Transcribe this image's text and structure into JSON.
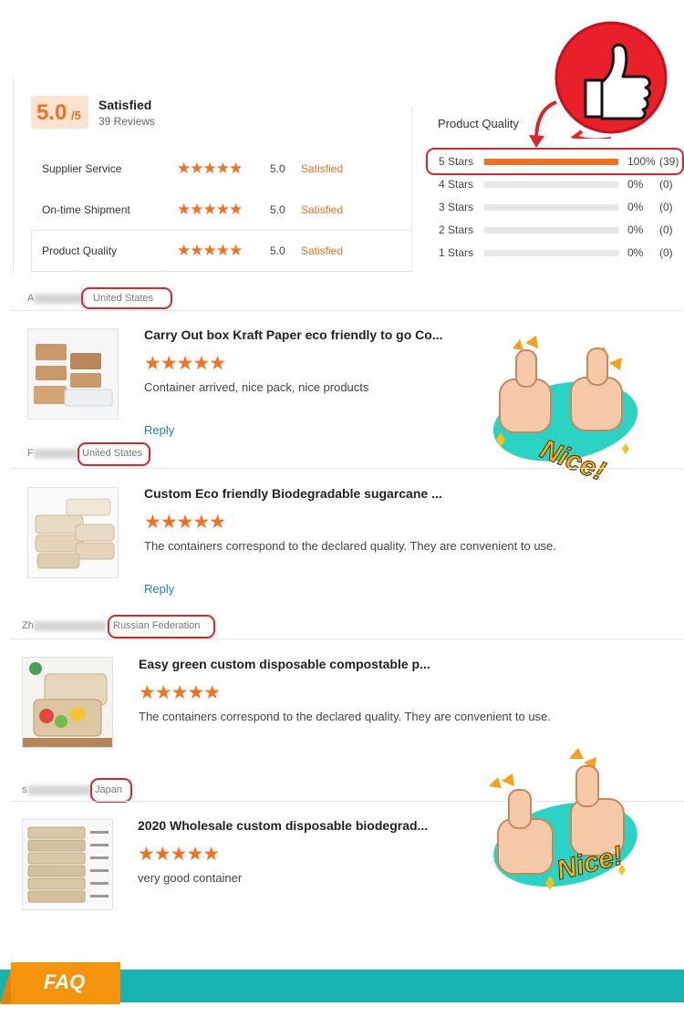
{
  "summary": {
    "score": "5.0",
    "score_suffix": "/5",
    "title": "Satisfied",
    "reviews": "39 Reviews",
    "metrics": [
      {
        "label": "Supplier Service",
        "stars": "★★★★★",
        "value": "5.0",
        "word": "Satisfied"
      },
      {
        "label": "On-time Shipment",
        "stars": "★★★★★",
        "value": "5.0",
        "word": "Satisfied"
      },
      {
        "label": "Product Quality",
        "stars": "★★★★★",
        "value": "5.0",
        "word": "Satisfied"
      }
    ]
  },
  "distribution": {
    "heading": "Product Quality",
    "rows": [
      {
        "label": "5 Stars",
        "pct": "100%",
        "count": "(39)",
        "fill": 1.0
      },
      {
        "label": "4 Stars",
        "pct": "0%",
        "count": "(0)",
        "fill": 0
      },
      {
        "label": "3 Stars",
        "pct": "0%",
        "count": "(0)",
        "fill": 0
      },
      {
        "label": "2 Stars",
        "pct": "0%",
        "count": "(0)",
        "fill": 0
      },
      {
        "label": "1 Stars",
        "pct": "0%",
        "count": "(0)",
        "fill": 0
      }
    ]
  },
  "reviews": [
    {
      "initial": "A",
      "country": "United States",
      "title": "Carry Out box Kraft Paper eco friendly to go Co...",
      "stars": "★★★★★",
      "text": "Container arrived, nice pack, nice products",
      "reply": "Reply"
    },
    {
      "initial": "F",
      "country": "United States",
      "title": "Custom Eco friendly Biodegradable sugarcane ...",
      "stars": "★★★★★",
      "text": "The containers correspond to the declared quality. They are convenient to use.",
      "reply": "Reply"
    },
    {
      "initial": "Zh",
      "country": "Russian Federation",
      "title": "Easy green custom disposable compostable p...",
      "stars": "★★★★★",
      "text": "The containers correspond to the declared quality. They are convenient to use.",
      "reply": ""
    },
    {
      "initial": "s",
      "country": "Japan",
      "title": "2020 Wholesale custom disposable biodegrad...",
      "stars": "★★★★★",
      "text": "very good container",
      "reply": ""
    }
  ],
  "stickers": {
    "nice": "Nice!"
  },
  "faq": {
    "label": "FAQ"
  },
  "colors": {
    "accent": "#f37021",
    "highlight": "#d9262c",
    "link": "#1a7fc4",
    "faq_band": "#17b3b1",
    "faq_tag": "#f5940c"
  }
}
